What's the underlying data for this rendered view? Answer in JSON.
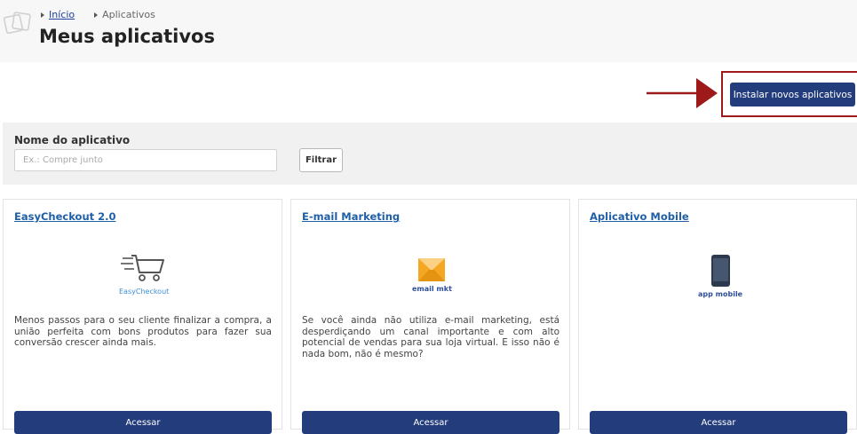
{
  "breadcrumb": {
    "home": "Início",
    "current": "Aplicativos"
  },
  "page": {
    "title": "Meus aplicativos"
  },
  "actions": {
    "install_label": "Instalar novos aplicativos"
  },
  "filter": {
    "label": "Nome do aplicativo",
    "placeholder": "Ex.: Compre junto",
    "value": "",
    "button_label": "Filtrar"
  },
  "apps": [
    {
      "title": "EasyCheckout 2.0",
      "logo": "shopping-cart-icon",
      "logo_caption": "EasyCheckout",
      "description": "Menos passos para o seu cliente finalizar a compra, a união perfeita com bons produtos para fazer sua conversão crescer ainda mais.",
      "button_label": "Acessar"
    },
    {
      "title": "E-mail Marketing",
      "logo": "envelope-icon",
      "logo_caption": "email mkt",
      "description": "Se você ainda não utiliza e-mail marketing, está desperdiçando um canal importante e com alto potencial de vendas para sua loja virtual. E isso não é nada bom, não é mesmo?",
      "button_label": "Acessar"
    },
    {
      "title": "Aplicativo Mobile",
      "logo": "smartphone-icon",
      "logo_caption": "app mobile",
      "description": "",
      "button_label": "Acessar"
    }
  ],
  "colors": {
    "primary": "#233c7c",
    "link": "#1f5fa8",
    "highlight": "#9e1a1a",
    "email_orange": "#f5a623"
  }
}
